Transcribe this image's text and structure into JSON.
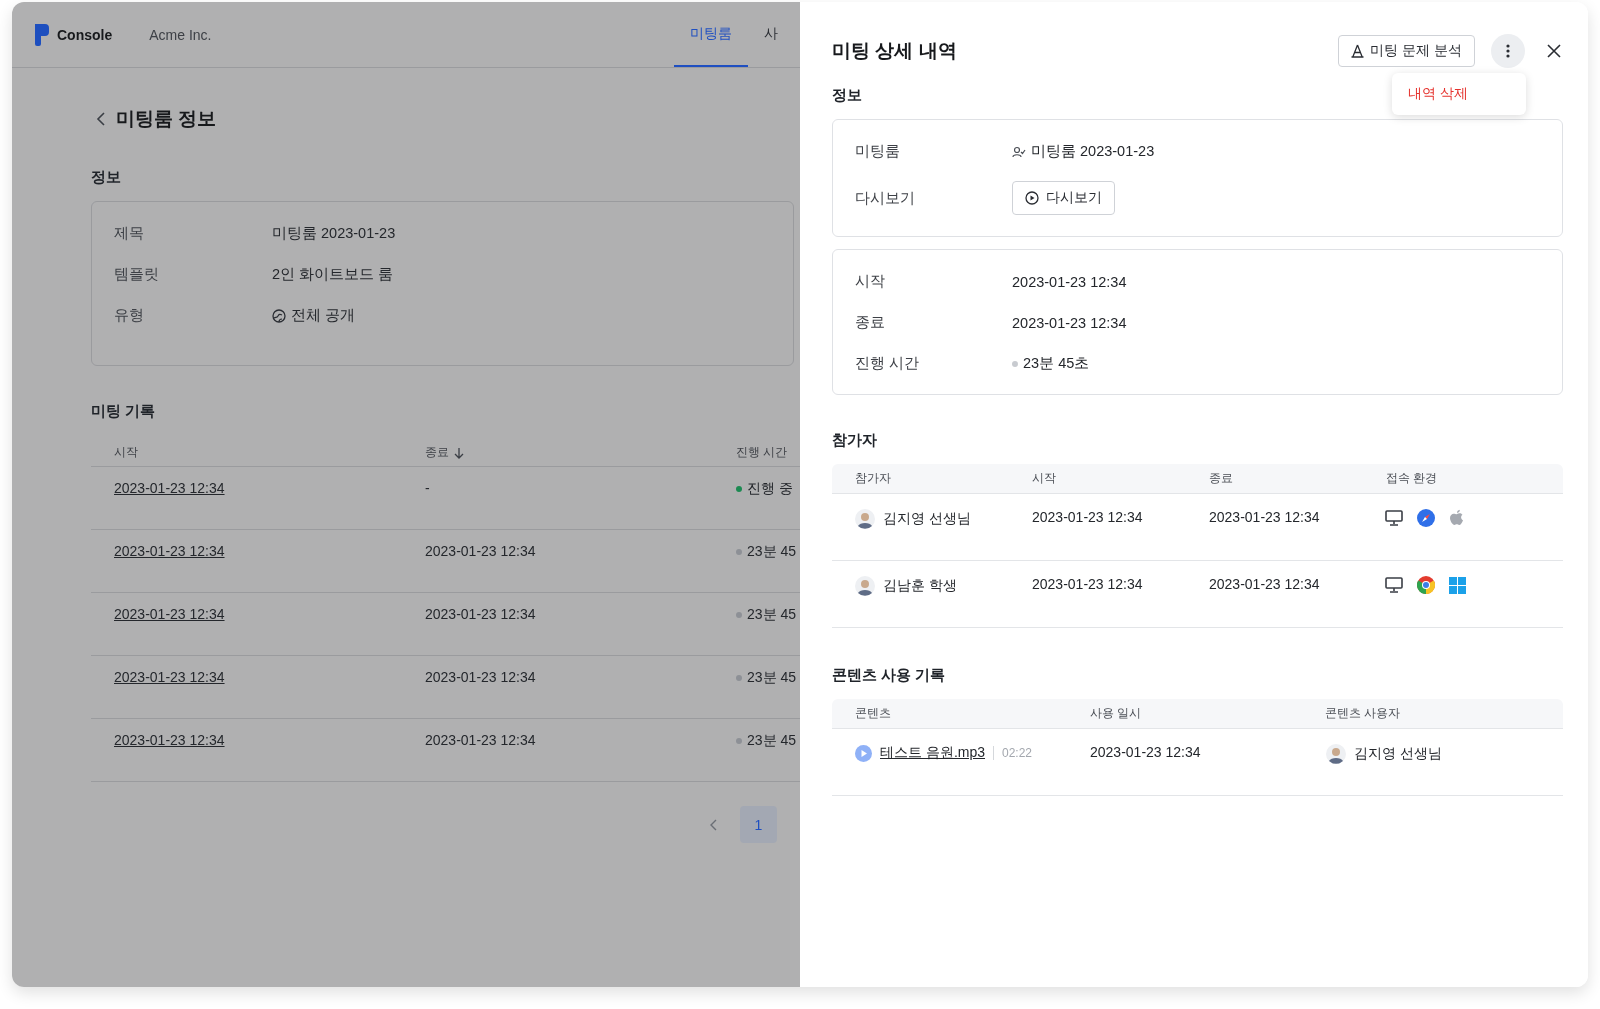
{
  "app": {
    "brand": "Console",
    "org": "Acme Inc.",
    "tabs": [
      {
        "label": "미팅룸",
        "selected": true
      },
      {
        "label": "사",
        "selected": false
      }
    ]
  },
  "page": {
    "title": "미팅룸 정보",
    "info_heading": "정보",
    "info": [
      {
        "label": "제목",
        "value": "미팅룸 2023-01-23",
        "kind": "text"
      },
      {
        "label": "템플릿",
        "value": "2인 화이트보드 룸",
        "kind": "text"
      },
      {
        "label": "유형",
        "value": "전체 공개",
        "kind": "public"
      }
    ],
    "records_heading": "미팅 기록",
    "records_columns": [
      {
        "label": "시작",
        "sorted": false
      },
      {
        "label": "종료",
        "sorted": true
      },
      {
        "label": "진행 시간",
        "sorted": false
      }
    ],
    "records": [
      {
        "start": "2023-01-23 12:34",
        "end": "-",
        "duration": "진행 중",
        "color": "#1c8a52"
      },
      {
        "start": "2023-01-23 12:34",
        "end": "2023-01-23 12:34",
        "duration": "23분 45",
        "color": "#8d9096"
      },
      {
        "start": "2023-01-23 12:34",
        "end": "2023-01-23 12:34",
        "duration": "23분 45",
        "color": "#8d9096"
      },
      {
        "start": "2023-01-23 12:34",
        "end": "2023-01-23 12:34",
        "duration": "23분 45",
        "color": "#8d9096"
      },
      {
        "start": "2023-01-23 12:34",
        "end": "2023-01-23 12:34",
        "duration": "23분 45",
        "color": "#8d9096"
      }
    ],
    "pages": [
      {
        "label": "1",
        "selected": true
      }
    ]
  },
  "drawer": {
    "title": "미팅 상세 내역",
    "analyze_button": "미팅 문제 분석",
    "menu": [
      {
        "label": "내역 삭제",
        "kind": "danger"
      }
    ],
    "info_heading": "정보",
    "room": {
      "label": "미팅룸",
      "value": "미팅룸 2023-01-23"
    },
    "replay": {
      "label": "다시보기",
      "button": "다시보기"
    },
    "times": [
      {
        "label": "시작",
        "value": "2023-01-23 12:34",
        "kind": "text"
      },
      {
        "label": "종료",
        "value": "2023-01-23 12:34",
        "kind": "text"
      },
      {
        "label": "진행 시간",
        "value": "23분 45초",
        "kind": "duration"
      }
    ],
    "participants_heading": "참가자",
    "participant_columns": [
      "참가자",
      "시작",
      "종료",
      "접속 환경"
    ],
    "participants": [
      {
        "name": "김지영 선생님",
        "start": "2023-01-23 12:34",
        "end": "2023-01-23 12:34",
        "env": [
          {
            "kind": "desktop"
          },
          {
            "kind": "compass"
          },
          {
            "kind": "apple"
          }
        ]
      },
      {
        "name": "김남훈 학생",
        "start": "2023-01-23 12:34",
        "end": "2023-01-23 12:34",
        "env": [
          {
            "kind": "desktop"
          },
          {
            "kind": "tricolor"
          },
          {
            "kind": "squares"
          }
        ]
      }
    ],
    "contents_heading": "콘텐츠 사용 기록",
    "content_columns": [
      "콘텐츠",
      "사용 일시",
      "콘텐츠 사용자"
    ],
    "contents": [
      {
        "title": "테스트 음원.mp3",
        "length": "02:22",
        "used_at": "2023-01-23 12:34",
        "user": "김지영 선생님"
      }
    ]
  }
}
